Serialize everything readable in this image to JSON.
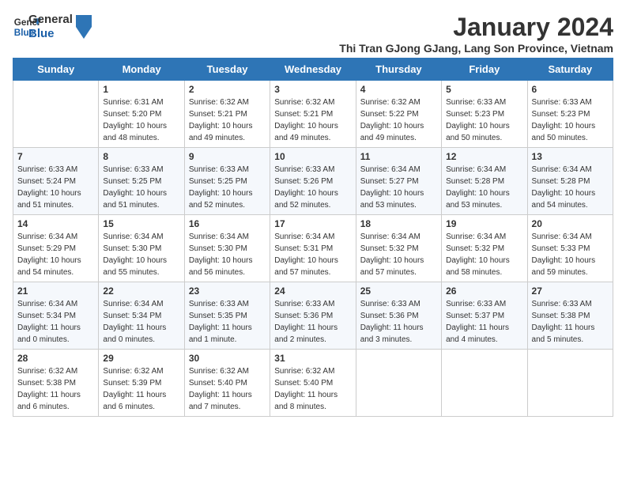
{
  "logo": {
    "line1": "General",
    "line2": "Blue"
  },
  "title": "January 2024",
  "subtitle": "Thi Tran GJong GJang, Lang Son Province, Vietnam",
  "days_of_week": [
    "Sunday",
    "Monday",
    "Tuesday",
    "Wednesday",
    "Thursday",
    "Friday",
    "Saturday"
  ],
  "weeks": [
    [
      {
        "day": null
      },
      {
        "day": "1",
        "sunrise": "6:31 AM",
        "sunset": "5:20 PM",
        "daylight": "10 hours and 48 minutes."
      },
      {
        "day": "2",
        "sunrise": "6:32 AM",
        "sunset": "5:21 PM",
        "daylight": "10 hours and 49 minutes."
      },
      {
        "day": "3",
        "sunrise": "6:32 AM",
        "sunset": "5:21 PM",
        "daylight": "10 hours and 49 minutes."
      },
      {
        "day": "4",
        "sunrise": "6:32 AM",
        "sunset": "5:22 PM",
        "daylight": "10 hours and 49 minutes."
      },
      {
        "day": "5",
        "sunrise": "6:33 AM",
        "sunset": "5:23 PM",
        "daylight": "10 hours and 50 minutes."
      },
      {
        "day": "6",
        "sunrise": "6:33 AM",
        "sunset": "5:23 PM",
        "daylight": "10 hours and 50 minutes."
      }
    ],
    [
      {
        "day": "7",
        "sunrise": "6:33 AM",
        "sunset": "5:24 PM",
        "daylight": "10 hours and 51 minutes."
      },
      {
        "day": "8",
        "sunrise": "6:33 AM",
        "sunset": "5:25 PM",
        "daylight": "10 hours and 51 minutes."
      },
      {
        "day": "9",
        "sunrise": "6:33 AM",
        "sunset": "5:25 PM",
        "daylight": "10 hours and 52 minutes."
      },
      {
        "day": "10",
        "sunrise": "6:33 AM",
        "sunset": "5:26 PM",
        "daylight": "10 hours and 52 minutes."
      },
      {
        "day": "11",
        "sunrise": "6:34 AM",
        "sunset": "5:27 PM",
        "daylight": "10 hours and 53 minutes."
      },
      {
        "day": "12",
        "sunrise": "6:34 AM",
        "sunset": "5:28 PM",
        "daylight": "10 hours and 53 minutes."
      },
      {
        "day": "13",
        "sunrise": "6:34 AM",
        "sunset": "5:28 PM",
        "daylight": "10 hours and 54 minutes."
      }
    ],
    [
      {
        "day": "14",
        "sunrise": "6:34 AM",
        "sunset": "5:29 PM",
        "daylight": "10 hours and 54 minutes."
      },
      {
        "day": "15",
        "sunrise": "6:34 AM",
        "sunset": "5:30 PM",
        "daylight": "10 hours and 55 minutes."
      },
      {
        "day": "16",
        "sunrise": "6:34 AM",
        "sunset": "5:30 PM",
        "daylight": "10 hours and 56 minutes."
      },
      {
        "day": "17",
        "sunrise": "6:34 AM",
        "sunset": "5:31 PM",
        "daylight": "10 hours and 57 minutes."
      },
      {
        "day": "18",
        "sunrise": "6:34 AM",
        "sunset": "5:32 PM",
        "daylight": "10 hours and 57 minutes."
      },
      {
        "day": "19",
        "sunrise": "6:34 AM",
        "sunset": "5:32 PM",
        "daylight": "10 hours and 58 minutes."
      },
      {
        "day": "20",
        "sunrise": "6:34 AM",
        "sunset": "5:33 PM",
        "daylight": "10 hours and 59 minutes."
      }
    ],
    [
      {
        "day": "21",
        "sunrise": "6:34 AM",
        "sunset": "5:34 PM",
        "daylight": "11 hours and 0 minutes."
      },
      {
        "day": "22",
        "sunrise": "6:34 AM",
        "sunset": "5:34 PM",
        "daylight": "11 hours and 0 minutes."
      },
      {
        "day": "23",
        "sunrise": "6:33 AM",
        "sunset": "5:35 PM",
        "daylight": "11 hours and 1 minute."
      },
      {
        "day": "24",
        "sunrise": "6:33 AM",
        "sunset": "5:36 PM",
        "daylight": "11 hours and 2 minutes."
      },
      {
        "day": "25",
        "sunrise": "6:33 AM",
        "sunset": "5:36 PM",
        "daylight": "11 hours and 3 minutes."
      },
      {
        "day": "26",
        "sunrise": "6:33 AM",
        "sunset": "5:37 PM",
        "daylight": "11 hours and 4 minutes."
      },
      {
        "day": "27",
        "sunrise": "6:33 AM",
        "sunset": "5:38 PM",
        "daylight": "11 hours and 5 minutes."
      }
    ],
    [
      {
        "day": "28",
        "sunrise": "6:32 AM",
        "sunset": "5:38 PM",
        "daylight": "11 hours and 6 minutes."
      },
      {
        "day": "29",
        "sunrise": "6:32 AM",
        "sunset": "5:39 PM",
        "daylight": "11 hours and 6 minutes."
      },
      {
        "day": "30",
        "sunrise": "6:32 AM",
        "sunset": "5:40 PM",
        "daylight": "11 hours and 7 minutes."
      },
      {
        "day": "31",
        "sunrise": "6:32 AM",
        "sunset": "5:40 PM",
        "daylight": "11 hours and 8 minutes."
      },
      {
        "day": null
      },
      {
        "day": null
      },
      {
        "day": null
      }
    ]
  ]
}
